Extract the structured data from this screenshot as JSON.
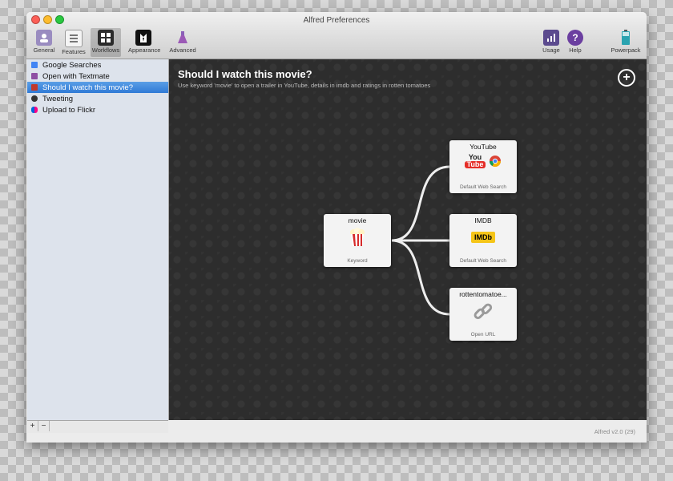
{
  "window": {
    "title": "Alfred Preferences"
  },
  "toolbar": {
    "general": "General",
    "features": "Features",
    "workflows": "Workflows",
    "appearance": "Appearance",
    "advanced": "Advanced",
    "usage": "Usage",
    "help": "Help",
    "powerpack": "Powerpack"
  },
  "sidebar": {
    "items": [
      {
        "label": "Google Searches",
        "color": "#4285f4"
      },
      {
        "label": "Open with Textmate",
        "color": "#8e4fa3"
      },
      {
        "label": "Should I watch this movie?",
        "color": "#c0392b"
      },
      {
        "label": "Tweeting",
        "color": "#333333"
      },
      {
        "label": "Upload to Flickr",
        "color": "#ff0084"
      }
    ],
    "add": "+",
    "remove": "−"
  },
  "workflow": {
    "title": "Should I watch this movie?",
    "description": "Use keyword 'movie' to open a trailer in YouTube, details in imdb and ratings in rotten tomatoes",
    "add": "+"
  },
  "nodes": {
    "keyword": {
      "title": "movie",
      "subtitle": "Keyword"
    },
    "youtube": {
      "title": "YouTube",
      "subtitle": "Default Web Search",
      "logo_top": "You",
      "logo_bottom": "Tube"
    },
    "imdb": {
      "title": "IMDB",
      "subtitle": "Default Web Search",
      "logo": "IMDb"
    },
    "rotten": {
      "title": "rottentomatoe...",
      "subtitle": "Open URL"
    }
  },
  "status": {
    "version": "Alfred v2.0 (29)"
  },
  "colors": {
    "selection": "#2f7ad6",
    "canvas": "#2d2d2d",
    "node": "#f3f3f3"
  }
}
